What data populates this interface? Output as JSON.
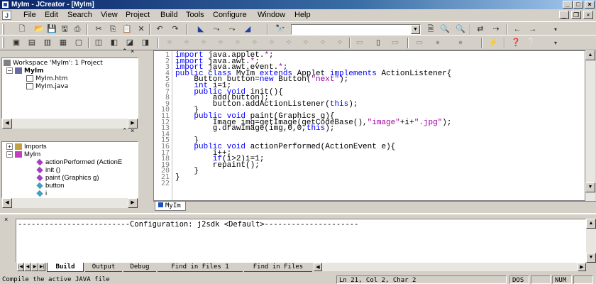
{
  "window": {
    "title": "MyIm - JCreator - [MyIm]",
    "min": "_",
    "max": "□",
    "close": "×"
  },
  "menu": [
    "File",
    "Edit",
    "Search",
    "View",
    "Project",
    "Build",
    "Tools",
    "Configure",
    "Window",
    "Help"
  ],
  "mdi_buttons": {
    "min": "_",
    "restore": "❐",
    "close": "×"
  },
  "toolbar": {
    "find_value": ""
  },
  "workspace": {
    "title_close": "×",
    "root": "Workspace 'MyIm': 1 Project",
    "project": "MyIm",
    "files": [
      "MyIm.htm",
      "MyIm.java"
    ]
  },
  "classview": {
    "imports": "Imports",
    "class": "MyIm",
    "members": [
      "actionPerformed (ActionE",
      "init ()",
      "paint (Graphics g)",
      "button",
      "i"
    ]
  },
  "editor": {
    "tab": "MyIm",
    "lines": [
      {
        "n": "1",
        "html": "<span class='kw'>import</span> java.applet.<span class='st'>*</span>;"
      },
      {
        "n": "2",
        "html": "<span class='kw'>import</span> java.awt.<span class='st'>*</span>;"
      },
      {
        "n": "3",
        "html": "<span class='kw'>import</span> java.awt.event.<span class='st'>*</span>;"
      },
      {
        "n": "4",
        "html": "<span class='kw'>public class</span> MyIm <span class='kw'>extends</span> Applet <span class='kw'>implements</span> ActionListener{"
      },
      {
        "n": "5",
        "html": "    Button button=<span class='kw'>new</span> Button(<span class='st'>\"next\"</span>);"
      },
      {
        "n": "6",
        "html": "    <span class='kw'>int</span> i=1;"
      },
      {
        "n": "7",
        "html": "    <span class='kw'>public void</span> init(){"
      },
      {
        "n": "8",
        "html": "        add(button);"
      },
      {
        "n": "9",
        "html": "        button.addActionListener(<span class='kw'>this</span>);"
      },
      {
        "n": "10",
        "html": "    }"
      },
      {
        "n": "11",
        "html": "    <span class='kw'>public void</span> paint(Graphics g){"
      },
      {
        "n": "12",
        "html": "        Image img=getImage(getCodeBase(),<span class='st'>\"image\"</span>+i+<span class='st'>\".jpg\"</span>);"
      },
      {
        "n": "13",
        "html": "        g.drawImage(img,0,0,<span class='kw'>this</span>);"
      },
      {
        "n": "14",
        "html": ""
      },
      {
        "n": "15",
        "html": "    }"
      },
      {
        "n": "16",
        "html": "    <span class='kw'>public void</span> actionPerformed(ActionEvent e){"
      },
      {
        "n": "17",
        "html": "        i++;"
      },
      {
        "n": "18",
        "html": "        <span class='kw'>if</span>(i>2)i=1;"
      },
      {
        "n": "19",
        "html": "        repaint();"
      },
      {
        "n": "20",
        "html": "    }"
      },
      {
        "n": "21",
        "html": "}"
      },
      {
        "n": "22",
        "html": ""
      }
    ]
  },
  "output": {
    "config_line": "-------------------------Configuration: j2sdk <Default>---------------------",
    "tabs": [
      "Build",
      "Output",
      "Debug",
      "Find in Files 1",
      "Find in Files"
    ]
  },
  "status": {
    "message": "Compile the active JAVA file",
    "position": "Ln 21, Col 2, Char 2",
    "dos": "DOS",
    "num": "NUM"
  }
}
